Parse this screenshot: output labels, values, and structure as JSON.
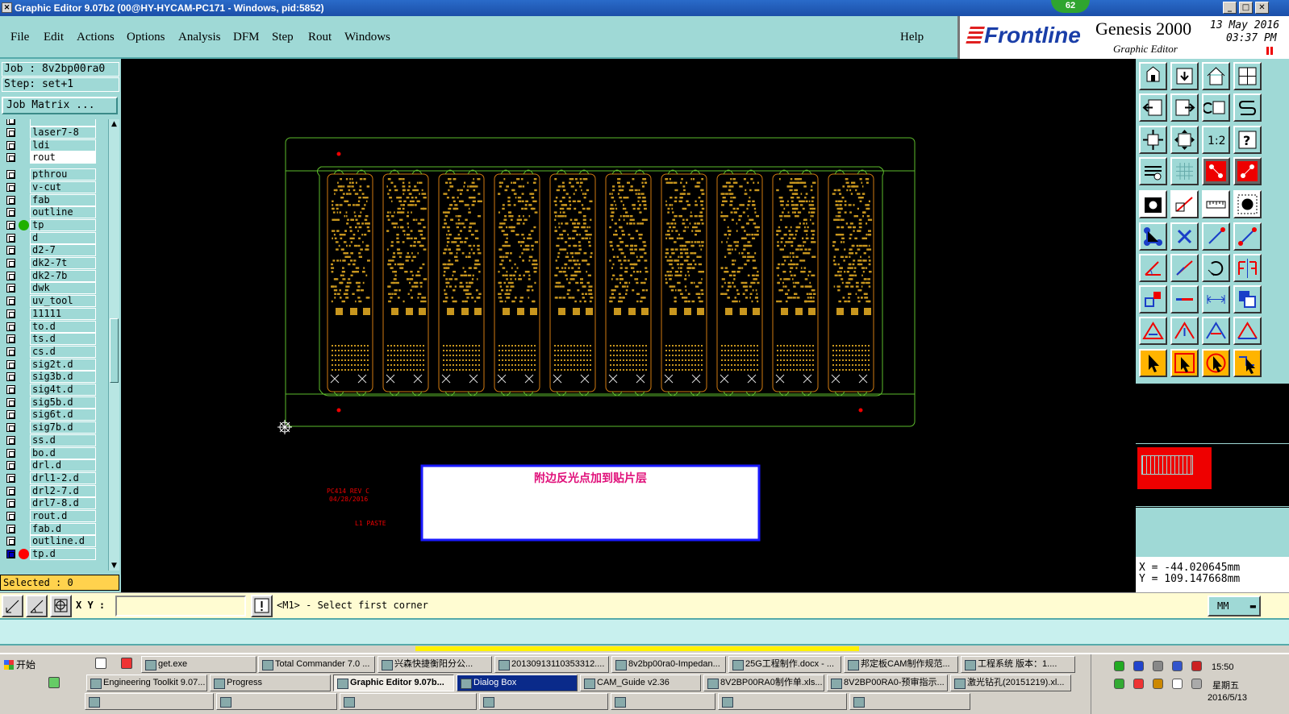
{
  "window": {
    "title": "Graphic Editor 9.07b2 (00@HY-HYCAM-PC171 - Windows, pid:5852)",
    "badge": "62"
  },
  "menu": [
    "File",
    "Edit",
    "Actions",
    "Options",
    "Analysis",
    "DFM",
    "Step",
    "Rout",
    "Windows"
  ],
  "help_label": "Help",
  "brand": {
    "logo": "Frontline",
    "product": "Genesis 2000",
    "subtitle": "Graphic Editor",
    "date": "13 May 2016",
    "time": "03:37 PM"
  },
  "job": {
    "job_line": "Job : 8v2bp00ra0",
    "step_line": "Step: set+1",
    "matrix_button": "Job Matrix ..."
  },
  "layers": [
    {
      "name": "laser7-8",
      "mark": ""
    },
    {
      "name": "ldi",
      "mark": ""
    },
    {
      "name": "rout",
      "mark": ""
    },
    {
      "name": "pthrou",
      "mark": ""
    },
    {
      "name": "v-cut",
      "mark": ""
    },
    {
      "name": "fab",
      "mark": ""
    },
    {
      "name": "outline",
      "mark": ""
    },
    {
      "name": "tp",
      "mark": "green"
    },
    {
      "name": "d",
      "mark": ""
    },
    {
      "name": "d2-7",
      "mark": ""
    },
    {
      "name": "dk2-7t",
      "mark": ""
    },
    {
      "name": "dk2-7b",
      "mark": ""
    },
    {
      "name": "dwk",
      "mark": ""
    },
    {
      "name": "uv_tool",
      "mark": ""
    },
    {
      "name": "11111",
      "mark": ""
    },
    {
      "name": "to.d",
      "mark": ""
    },
    {
      "name": "ts.d",
      "mark": ""
    },
    {
      "name": "cs.d",
      "mark": ""
    },
    {
      "name": "sig2t.d",
      "mark": ""
    },
    {
      "name": "sig3b.d",
      "mark": ""
    },
    {
      "name": "sig4t.d",
      "mark": ""
    },
    {
      "name": "sig5b.d",
      "mark": ""
    },
    {
      "name": "sig6t.d",
      "mark": ""
    },
    {
      "name": "sig7b.d",
      "mark": ""
    },
    {
      "name": "ss.d",
      "mark": ""
    },
    {
      "name": "bo.d",
      "mark": ""
    },
    {
      "name": "drl.d",
      "mark": ""
    },
    {
      "name": "drl1-2.d",
      "mark": ""
    },
    {
      "name": "drl2-7.d",
      "mark": ""
    },
    {
      "name": "drl7-8.d",
      "mark": ""
    },
    {
      "name": "rout.d",
      "mark": ""
    },
    {
      "name": "fab.d",
      "mark": ""
    },
    {
      "name": "outline.d",
      "mark": ""
    },
    {
      "name": "tp.d",
      "mark": "red"
    }
  ],
  "selected_label": "Selected : 0",
  "canvas": {
    "panel_count": 10,
    "annotation_lines": [
      "PC414 REV C",
      "04/28/2016"
    ],
    "paste_label": "L1 PASTE",
    "note_text": "附边反光点加到贴片层"
  },
  "coords": {
    "x": "X = -44.020645mm",
    "y": "Y = 109.147668mm"
  },
  "command": {
    "xy_label": "X Y :",
    "xy_value": "",
    "prompt": "<M1> - Select first corner",
    "units": "MM"
  },
  "taskbar": {
    "start": "开始",
    "row1": [
      "get.exe",
      "Total Commander 7.0 ...",
      "兴森快捷衡阳分公...",
      "20130913110353312....",
      "8v2bp00ra0-Impedan...",
      "25G工程制作.docx - ...",
      "邦定板CAM制作规范...",
      "工程系统  版本：1...."
    ],
    "row2": [
      "Engineering Toolkit 9.07...",
      "Progress",
      "Graphic Editor 9.07b...",
      "Dialog Box",
      "CAM_Guide v2.36",
      "8V2BP00RA0制作单.xls...",
      "8V2BP00RA0-预审指示...",
      "激光钻孔(20151219).xl..."
    ],
    "clock_time": "15:50",
    "clock_day": "星期五",
    "clock_date": "2016/5/13"
  },
  "colors": {
    "panel": "#9fd9d6",
    "canvas": "#000000",
    "board_outline": "#5dbb2c",
    "pad": "#c8961e",
    "accent_red": "#e00000",
    "note_border": "#1a1aff",
    "note_text": "#e0107a"
  }
}
